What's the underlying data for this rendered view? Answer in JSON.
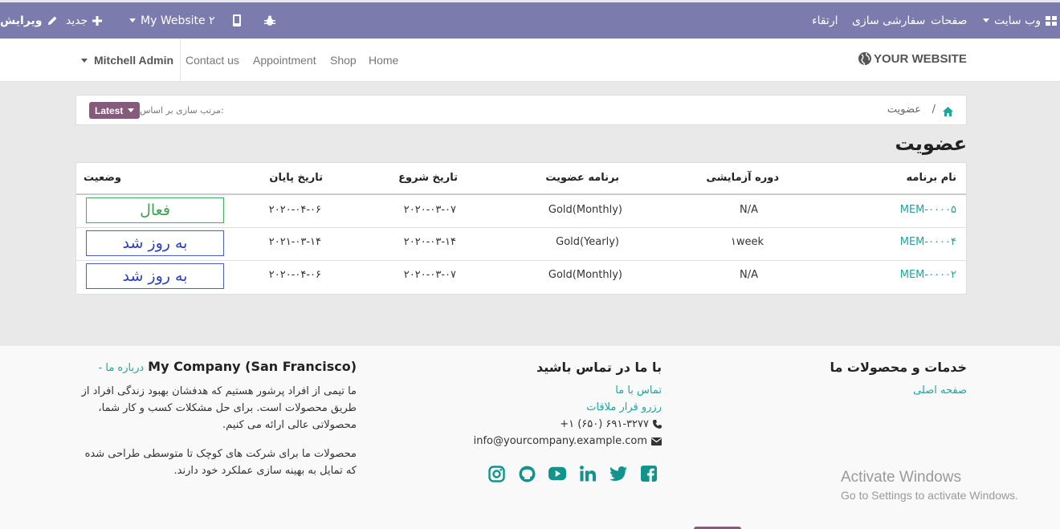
{
  "adminbar": {
    "website_menu": "وب سایت",
    "pages": "صفحات",
    "customize": "سفارشی سازی",
    "upgrade": "ارتقاء",
    "website_switcher": "My Website ۲",
    "new": "جدید",
    "edit": "ویرایش"
  },
  "navbar": {
    "logo": "YOUR WEBSITE",
    "menu": [
      "Home",
      "Shop",
      "Appointment",
      "Contact us"
    ],
    "user": "Mitchell Admin"
  },
  "breadcrumb": {
    "current": "عضویت",
    "separator": "/"
  },
  "sort": {
    "label": "مرتب سازی بر اساس:",
    "value": "Latest"
  },
  "page_title": "عضویت",
  "table": {
    "headers": {
      "program": "نام برنامه",
      "trial": "دوره آزمایشی",
      "plan": "برنامه عضویت",
      "start": "تاریخ شروع",
      "end": "تاریخ پایان",
      "status": "وضعیت"
    },
    "rows": [
      {
        "program": "MEM-۰۰۰۰۵",
        "trial": "N/A",
        "plan": "Gold(Monthly)",
        "start": "۲۰۲۰-۰۳-۰۷",
        "end": "۲۰۲۰-۰۴-۰۶",
        "status": "فعال",
        "status_color": "#3aa24f"
      },
      {
        "program": "MEM-۰۰۰۰۴",
        "trial": "۱week",
        "plan": "Gold(Yearly)",
        "start": "۲۰۲۰-۰۳-۱۴",
        "end": "۲۰۲۱-۰۳-۱۴",
        "status": "به روز شد",
        "status_color": "#2c3fc4"
      },
      {
        "program": "MEM-۰۰۰۰۲",
        "trial": "N/A",
        "plan": "Gold(Monthly)",
        "start": "۲۰۲۰-۰۳-۰۷",
        "end": "۲۰۲۰-۰۴-۰۶",
        "status": "به روز شد",
        "status_color": "#2c3fc4"
      }
    ]
  },
  "footer": {
    "services_title": "خدمات و محصولات ما",
    "services_link": "صفحه اصلی",
    "contact_title": "با ما در تماس باشید",
    "contact_links": [
      "تماس با ما",
      "رزرو قرار ملاقات"
    ],
    "phone": "+۱ (۶۵۰) ۶۹۱-۳۲۷۷",
    "email": "info@yourcompany.example.com",
    "company_title": "My Company (San Francisco)",
    "about_link": "- درباره ما",
    "about_p1": "ما تیمی از افراد پرشور هستیم که هدفشان بهبود زندگی افراد از طریق محصولات است. برای حل مشکلات کسب و کار شما، محصولاتی عالی ارائه می کنیم.",
    "about_p2": "محصولات ما برای شرکت های کوچک تا متوسطی طراحی شده که تمایل به بهینه سازی عملکرد خود دارند.",
    "social_icons": [
      "facebook-icon",
      "twitter-icon",
      "linkedin-icon",
      "youtube-icon",
      "github-icon",
      "instagram-icon"
    ]
  },
  "watermark": {
    "line1": "Activate Windows",
    "line2": "Go to Settings to activate Windows."
  },
  "colors": {
    "adminbar": "#7c7bad",
    "accent": "#875a7b",
    "link": "#21a49b"
  }
}
